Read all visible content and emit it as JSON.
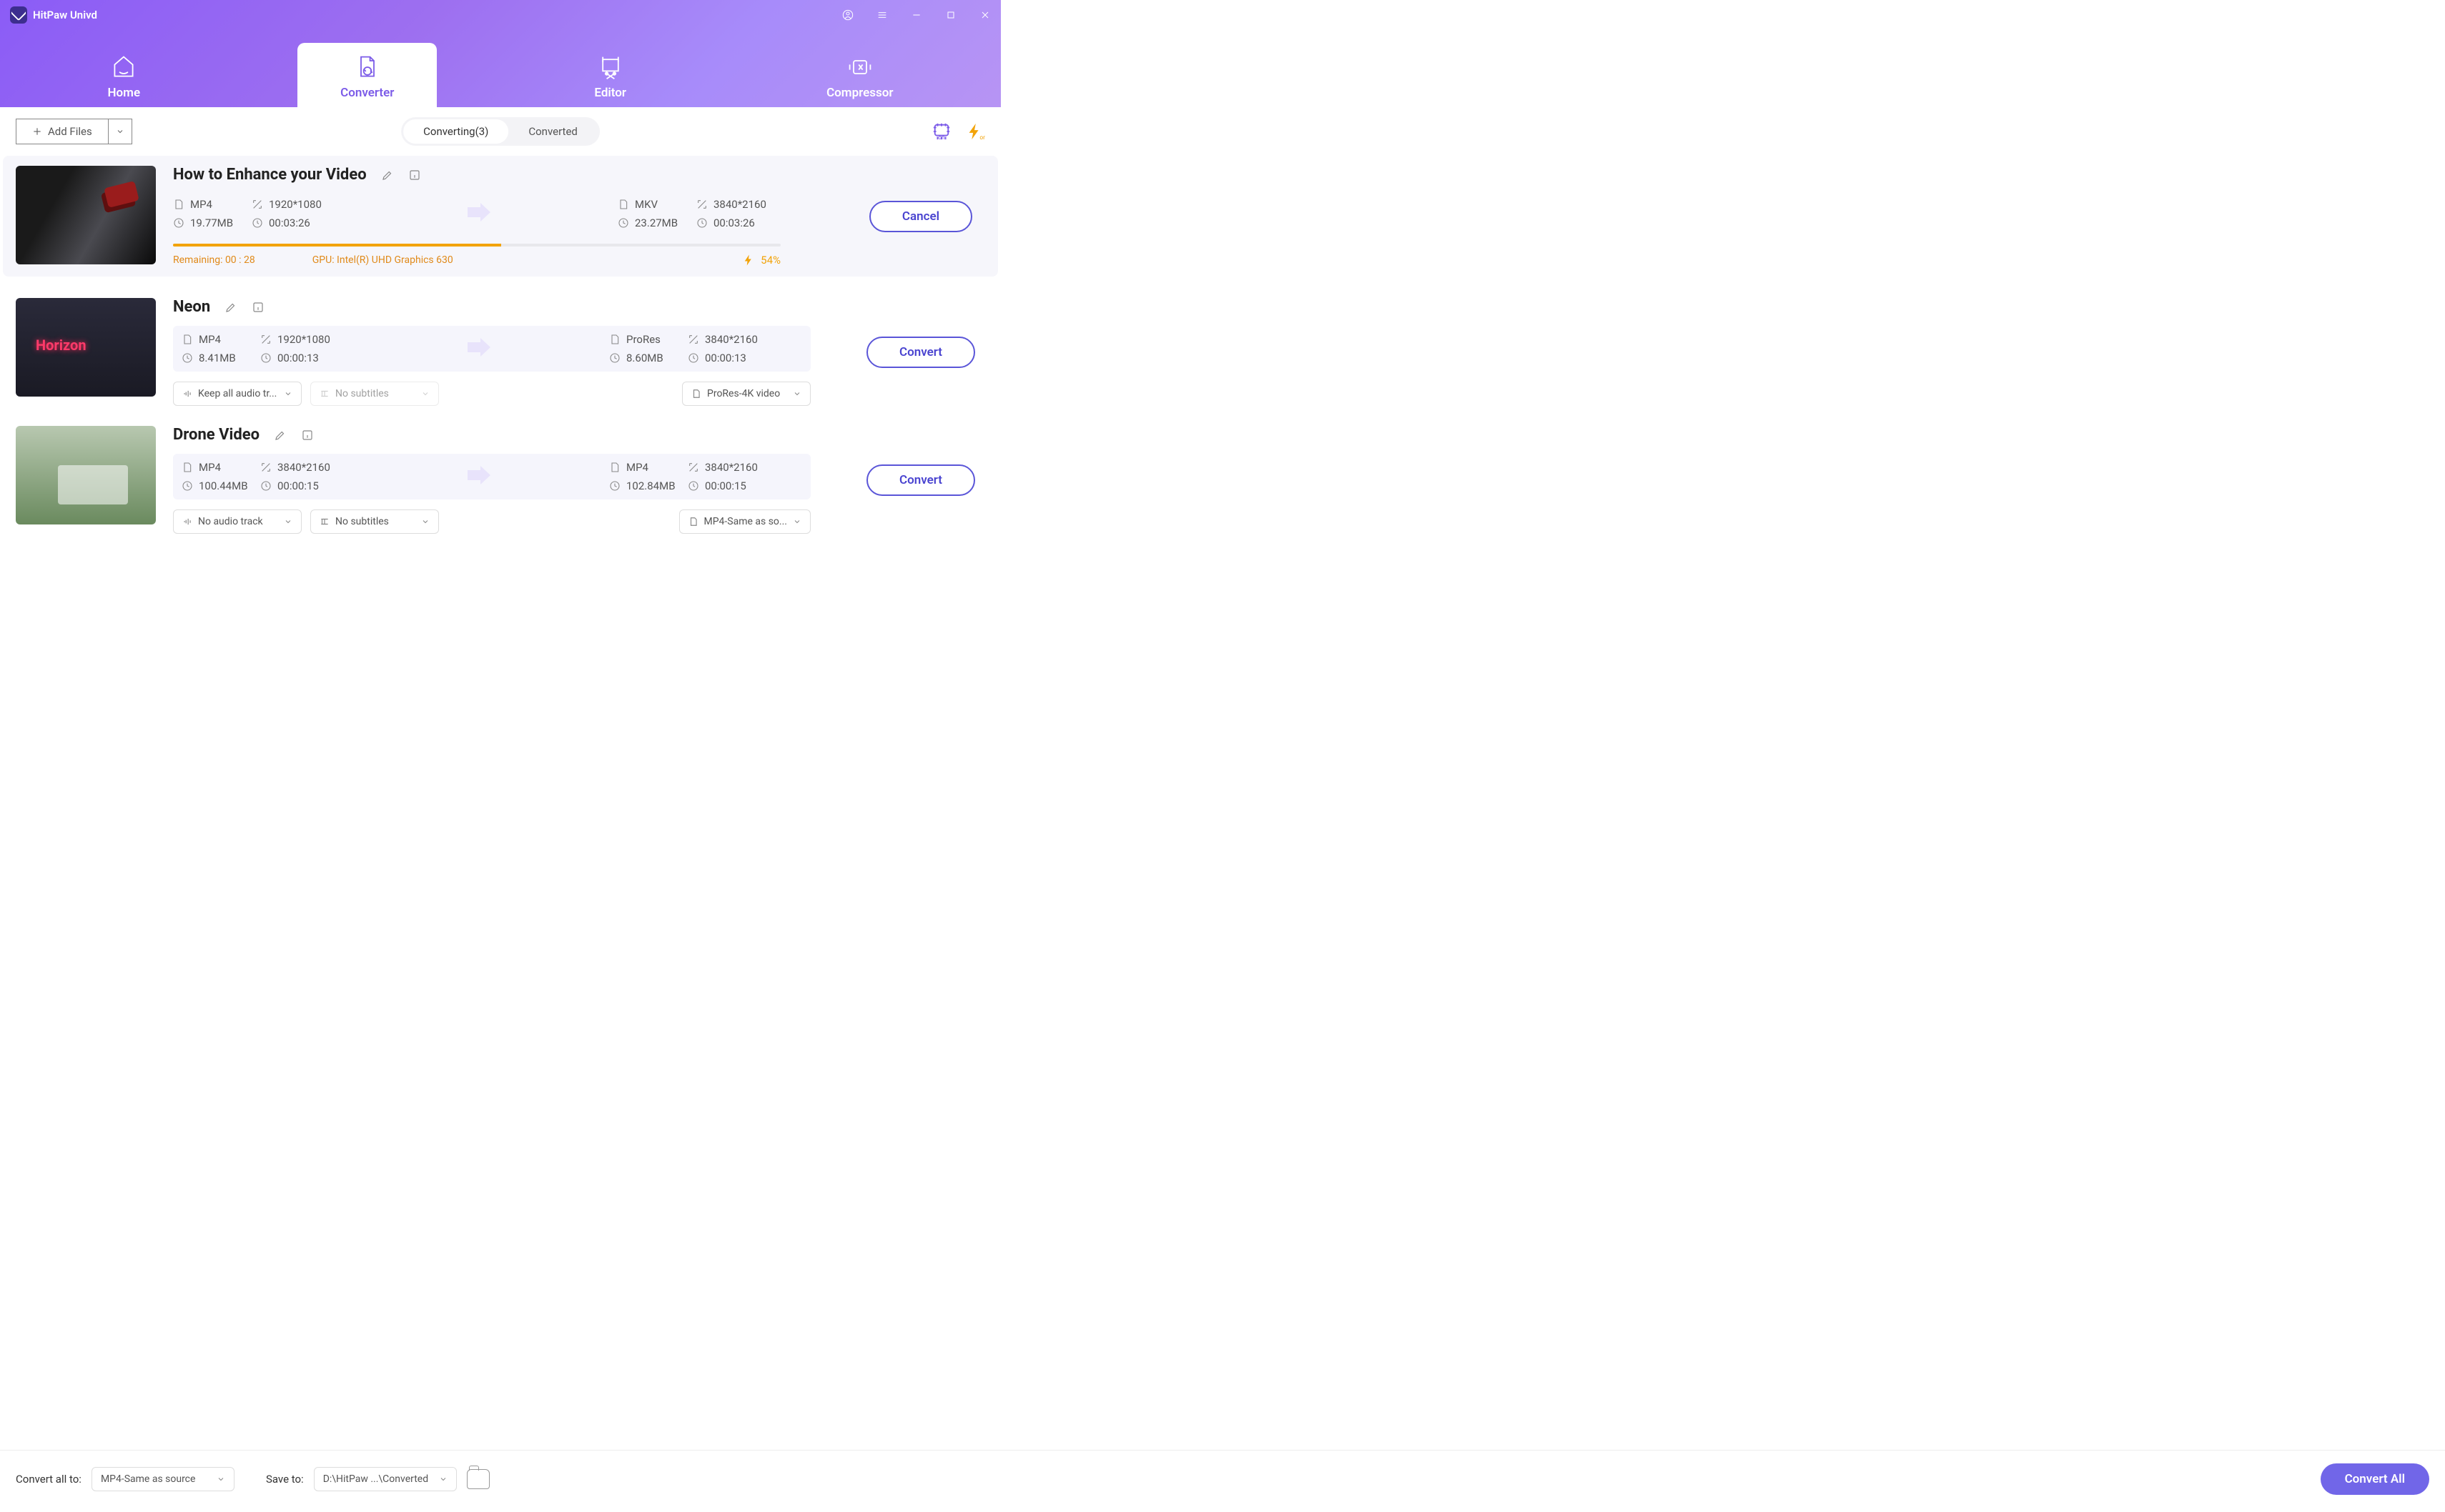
{
  "app": {
    "title": "HitPaw Univd"
  },
  "nav": {
    "home": "Home",
    "converter": "Converter",
    "editor": "Editor",
    "compressor": "Compressor"
  },
  "toolbar": {
    "add_files": "Add Files",
    "sub_converting": "Converting(3)",
    "sub_converted": "Converted",
    "hw_badge": "on",
    "light_badge": "on"
  },
  "items": [
    {
      "title": "How to Enhance your Video",
      "src": {
        "fmt": "MP4",
        "res": "1920*1080",
        "size": "19.77MB",
        "dur": "00:03:26"
      },
      "dst": {
        "fmt": "MKV",
        "res": "3840*2160",
        "size": "23.27MB",
        "dur": "00:03:26"
      },
      "remaining": "Remaining: 00 : 28",
      "gpu": "GPU: Intel(R) UHD Graphics 630",
      "percent": "54%",
      "progress_pct": 54,
      "action": "Cancel"
    },
    {
      "title": "Neon",
      "src": {
        "fmt": "MP4",
        "res": "1920*1080",
        "size": "8.41MB",
        "dur": "00:00:13"
      },
      "dst": {
        "fmt": "ProRes",
        "res": "3840*2160",
        "size": "8.60MB",
        "dur": "00:00:13"
      },
      "audio_sel": "Keep all audio tr...",
      "sub_sel": "No subtitles",
      "out_sel": "ProRes-4K video",
      "action": "Convert"
    },
    {
      "title": "Drone Video",
      "src": {
        "fmt": "MP4",
        "res": "3840*2160",
        "size": "100.44MB",
        "dur": "00:00:15"
      },
      "dst": {
        "fmt": "MP4",
        "res": "3840*2160",
        "size": "102.84MB",
        "dur": "00:00:15"
      },
      "audio_sel": "No audio track",
      "sub_sel": "No subtitles",
      "out_sel": "MP4-Same as so...",
      "action": "Convert"
    }
  ],
  "footer": {
    "convert_all_to_label": "Convert all to:",
    "convert_all_to_value": "MP4-Same as source",
    "save_to_label": "Save to:",
    "save_to_value": "D:\\HitPaw ...\\Converted",
    "convert_all_btn": "Convert All"
  }
}
